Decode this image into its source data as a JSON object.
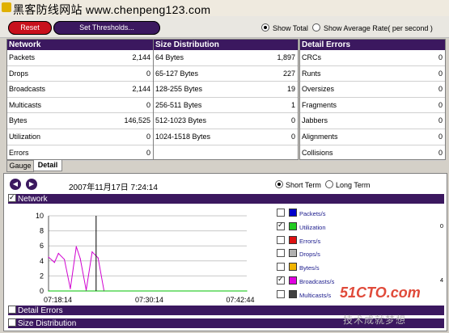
{
  "watermark": {
    "text": "黑客防线网站  www.chenpeng123.com"
  },
  "toolbar": {
    "reset_label": "Reset",
    "thresholds_label": "Set Thresholds...",
    "show_total_label": "Show Total",
    "show_average_label": "Show Average Rate( per second )",
    "selected_mode": "Show Total"
  },
  "network": {
    "title": "Network",
    "rows": [
      {
        "label": "Packets",
        "value": "2,144"
      },
      {
        "label": "Drops",
        "value": "0"
      },
      {
        "label": "Broadcasts",
        "value": "2,144"
      },
      {
        "label": "Multicasts",
        "value": "0"
      },
      {
        "label": "Bytes",
        "value": "146,525"
      },
      {
        "label": "Utilization",
        "value": "0"
      },
      {
        "label": "Errors",
        "value": "0"
      }
    ]
  },
  "size_distribution": {
    "title": "Size Distribution",
    "rows": [
      {
        "label": "64 Bytes",
        "value": "1,897"
      },
      {
        "label": "65-127 Bytes",
        "value": "227"
      },
      {
        "label": "128-255 Bytes",
        "value": "19"
      },
      {
        "label": "256-511 Bytes",
        "value": "1"
      },
      {
        "label": "512-1023 Bytes",
        "value": "0"
      },
      {
        "label": "1024-1518 Bytes",
        "value": "0"
      }
    ]
  },
  "detail_errors": {
    "title": "Detail Errors",
    "rows": [
      {
        "label": "CRCs",
        "value": "0"
      },
      {
        "label": "Runts",
        "value": "0"
      },
      {
        "label": "Oversizes",
        "value": "0"
      },
      {
        "label": "Fragments",
        "value": "0"
      },
      {
        "label": "Jabbers",
        "value": "0"
      },
      {
        "label": "Alignments",
        "value": "0"
      },
      {
        "label": "Collisions",
        "value": "0"
      }
    ]
  },
  "tabs": {
    "gauge": "Gauge",
    "detail": "Detail",
    "active": "Detail"
  },
  "lower": {
    "timestamp": "2007年11月17日  7:24:14",
    "short_term_label": "Short Term",
    "long_term_label": "Long Term",
    "selected_term": "Short Term",
    "network_section": "Network",
    "detail_errors_section": "Detail Errors",
    "size_distribution_section": "Size Distribution",
    "nav_back_icon": "circle-arrow-left-icon",
    "nav_forward_icon": "circle-arrow-right-icon"
  },
  "chart_data": {
    "type": "line",
    "title": "",
    "xlabel": "",
    "ylabel": "",
    "ylim": [
      0,
      10
    ],
    "yticks": [
      "10",
      "8",
      "6",
      "4",
      "2",
      "0"
    ],
    "xtick_labels": [
      "07:18:14",
      "07:30:14",
      "07:42:44"
    ],
    "series": [
      {
        "name": "Broadcasts/s",
        "color": "#d000d0",
        "x": [
          0,
          3,
          5,
          8,
          11,
          14,
          16,
          19,
          22,
          25,
          28
        ],
        "y": [
          4.5,
          3.8,
          5.0,
          4.2,
          0.3,
          5.9,
          4.3,
          0.1,
          5.2,
          4.4,
          0.0
        ]
      },
      {
        "name": "Utilization",
        "color": "#00c000",
        "x": [
          0,
          100
        ],
        "y": [
          0,
          0
        ]
      }
    ],
    "xrange": [
      0,
      100
    ],
    "cursor_x": 24
  },
  "legend": [
    {
      "label": "Packets/s",
      "color": "#0000cc",
      "checked": false,
      "value": ""
    },
    {
      "label": "Utilization",
      "color": "#22cc22",
      "checked": true,
      "value": "0"
    },
    {
      "label": "Errors/s",
      "color": "#dd1111",
      "checked": false,
      "value": ""
    },
    {
      "label": "Drops/s",
      "color": "#b0b0b0",
      "checked": false,
      "value": ""
    },
    {
      "label": "Bytes/s",
      "color": "#f0b400",
      "checked": false,
      "value": ""
    },
    {
      "label": "Broadcasts/s",
      "color": "#e000e0",
      "checked": true,
      "value": "4"
    },
    {
      "label": "Multicasts/s",
      "color": "#404040",
      "checked": false,
      "value": ""
    }
  ],
  "site_watermark": {
    "logo": "51CTO.com",
    "sub": "技术成就梦想"
  }
}
